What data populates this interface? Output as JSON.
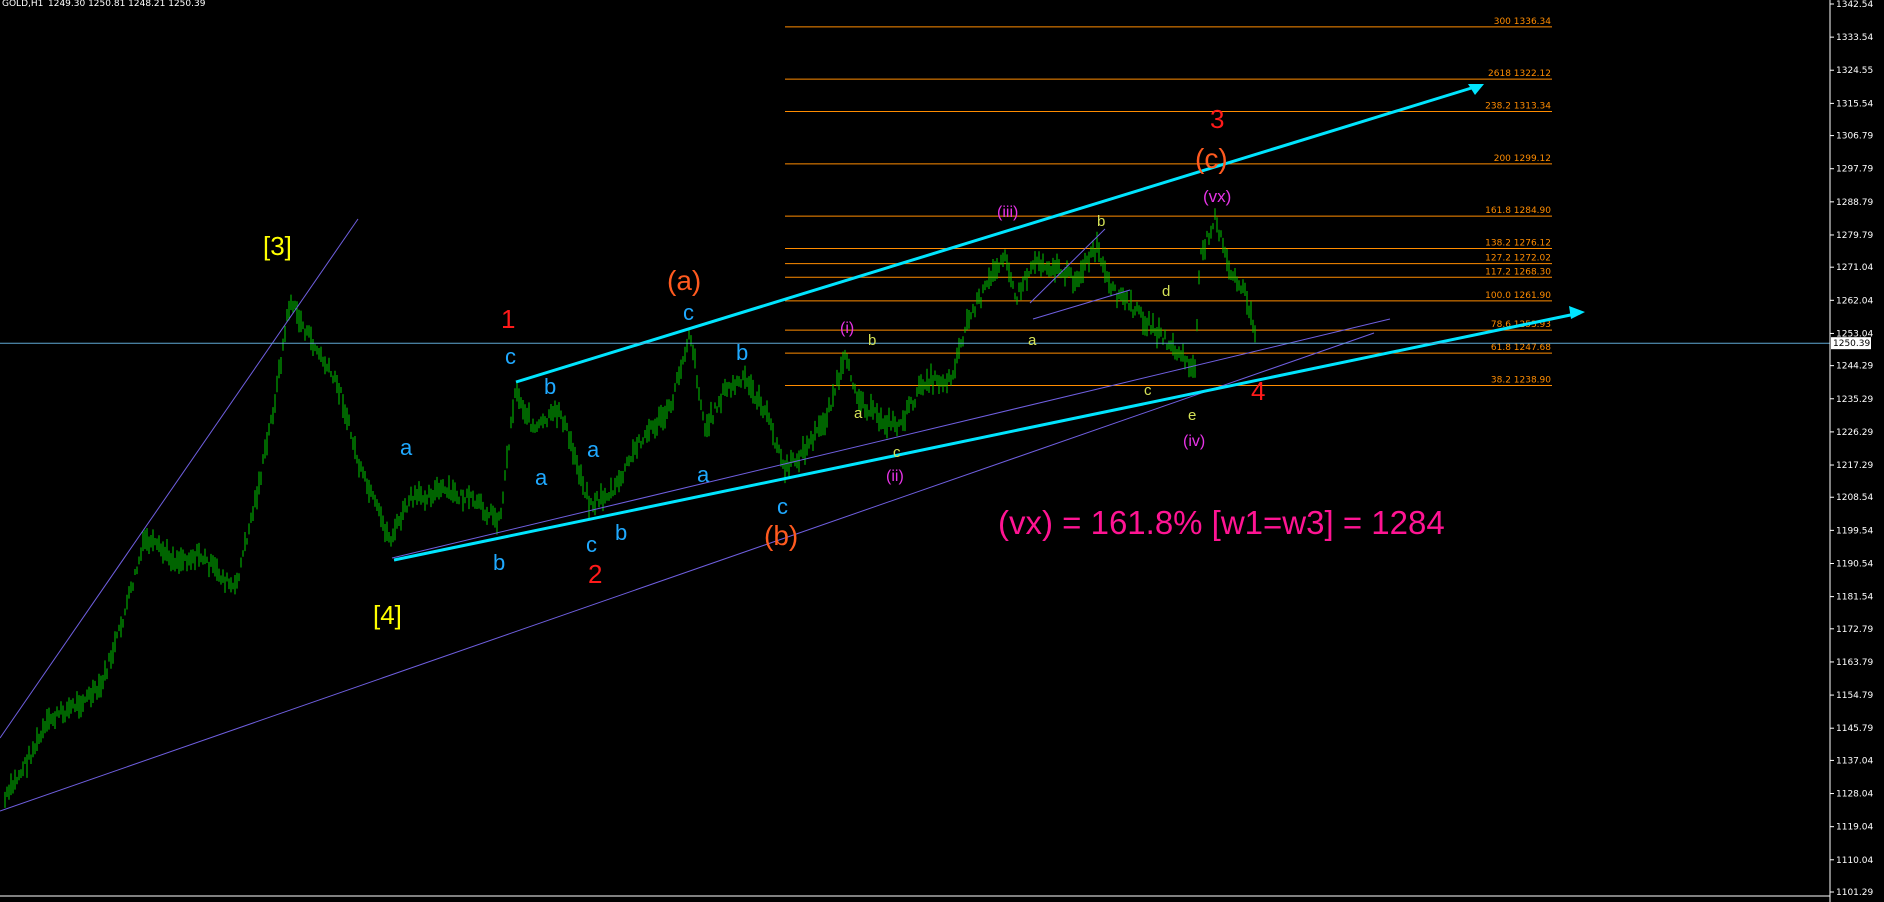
{
  "header": {
    "symbol_info": "GOLD,H1",
    "ohlc": "1249.30 1250.81 1248.21 1250.39"
  },
  "price_axis": {
    "ticks": [
      "1342.54",
      "1333.54",
      "1324.55",
      "1315.54",
      "1306.79",
      "1297.79",
      "1288.79",
      "1279.79",
      "1271.04",
      "1262.04",
      "1253.04",
      "1244.29",
      "1235.29",
      "1226.29",
      "1217.29",
      "1208.54",
      "1199.54",
      "1190.54",
      "1181.54",
      "1172.79",
      "1163.79",
      "1154.79",
      "1145.79",
      "1137.04",
      "1128.04",
      "1119.04",
      "1110.04",
      "1101.29"
    ],
    "current_price": "1250.39",
    "min": 1101.29,
    "max": 1342.54
  },
  "fib_levels": [
    {
      "label": "300 1336.34",
      "price": 1336.34
    },
    {
      "label": "2618 1322.12",
      "price": 1322.12
    },
    {
      "label": "238.2 1313.34",
      "price": 1313.34
    },
    {
      "label": "200 1299.12",
      "price": 1299.12
    },
    {
      "label": "161.8 1284.90",
      "price": 1284.9
    },
    {
      "label": "138.2 1276.12",
      "price": 1276.12
    },
    {
      "label": "127.2 1272.02",
      "price": 1272.02
    },
    {
      "label": "117.2 1268.30",
      "price": 1268.3
    },
    {
      "label": "100.0 1261.90",
      "price": 1261.9
    },
    {
      "label": "78.6 1253.93",
      "price": 1253.93
    },
    {
      "label": "61.8 1247.68",
      "price": 1247.68
    },
    {
      "label": "38.2 1238.90",
      "price": 1238.9
    }
  ],
  "wave_labels": {
    "w3_primary": "[3]",
    "w4_primary": "[4]",
    "w1_red": "1",
    "w2_red": "2",
    "w3_red": "3",
    "w4_red": "4",
    "wa_orange": "(a)",
    "wb_orange": "(b)",
    "wc_orange": "(c)",
    "vx": "(vx)",
    "i": "(i)",
    "ii": "(ii)",
    "iii": "(iii)",
    "iv": "(iv)",
    "blue_a1": "a",
    "blue_b1": "b",
    "blue_c1": "c",
    "blue_b2": "b",
    "blue_a2": "a",
    "blue_c2": "c",
    "blue_a3": "a",
    "blue_b3": "b",
    "blue_c3": "c",
    "blue_a4": "a",
    "blue_b4": "b",
    "blue_c4": "c",
    "y_a1": "a",
    "y_b1": "b",
    "y_c1": "c",
    "y_a2": "a",
    "y_b2": "b",
    "y_c2": "c",
    "y_d2": "d",
    "y_e2": "e"
  },
  "annotation": "(vx) = 161.8% [w1=w3] = 1284",
  "colors": {
    "background": "#000000",
    "candles": "#00c800",
    "channel": "#00e5ff",
    "fib": "#ff8c00",
    "trendline": "#7b68ee",
    "annotation": "#ff1493"
  }
}
